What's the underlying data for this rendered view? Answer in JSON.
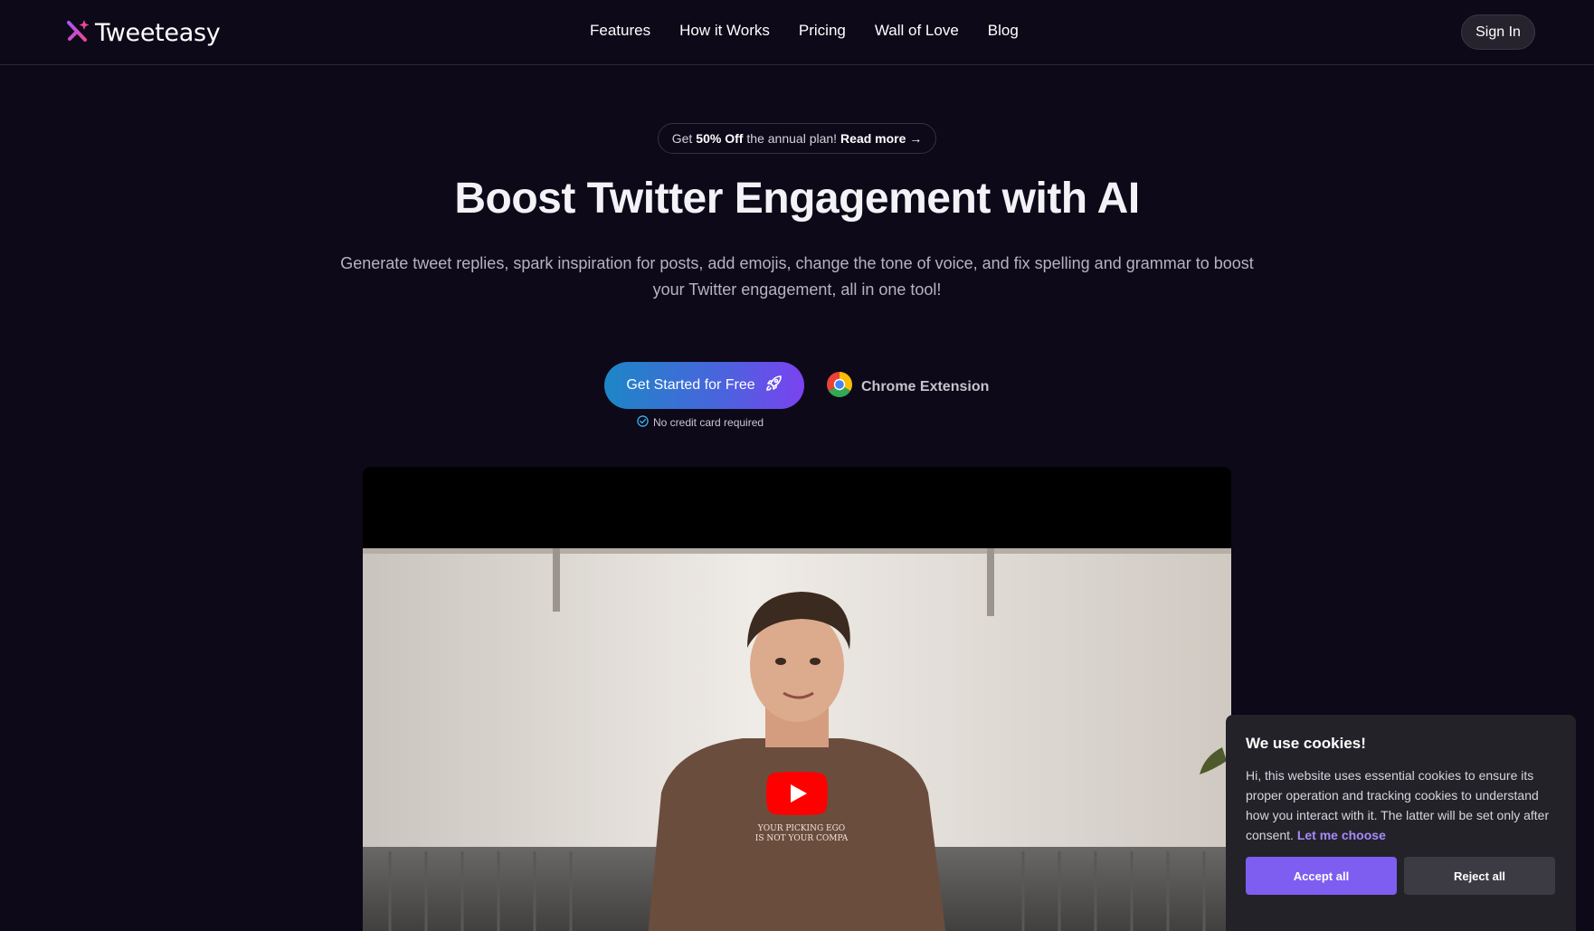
{
  "header": {
    "brand": "Tweeteasy",
    "nav": [
      "Features",
      "How it Works",
      "Pricing",
      "Wall of Love",
      "Blog"
    ],
    "sign_in": "Sign In"
  },
  "promo": {
    "prefix": "Get",
    "discount": "50% Off",
    "middle": "the annual plan!",
    "link": "Read more →"
  },
  "hero": {
    "title": "Boost Twitter Engagement with AI",
    "subtitle": "Generate tweet replies, spark inspiration for posts, add emojis, change the tone of voice, and fix spelling and grammar to boost your Twitter engagement, all in one tool!",
    "cta_label": "Get Started for Free",
    "no_card": "No credit card required",
    "chrome_label": "Chrome Extension"
  },
  "video": {
    "shirt_text_line1": "YOUR PICKING EGO",
    "shirt_text_line2": "IS NOT YOUR COMPA"
  },
  "cookie": {
    "title": "We use cookies!",
    "body": "Hi, this website uses essential cookies to ensure its proper operation and tracking cookies to understand how you interact with it. The latter will be set only after consent.",
    "link": "Let me choose",
    "accept": "Accept all",
    "reject": "Reject all"
  },
  "colors": {
    "background": "#0d0918",
    "accent": "#7e5ef0",
    "cta_gradient_start": "#1d86c6",
    "cta_gradient_end": "#7b42f0",
    "youtube_red": "#ff0000"
  }
}
